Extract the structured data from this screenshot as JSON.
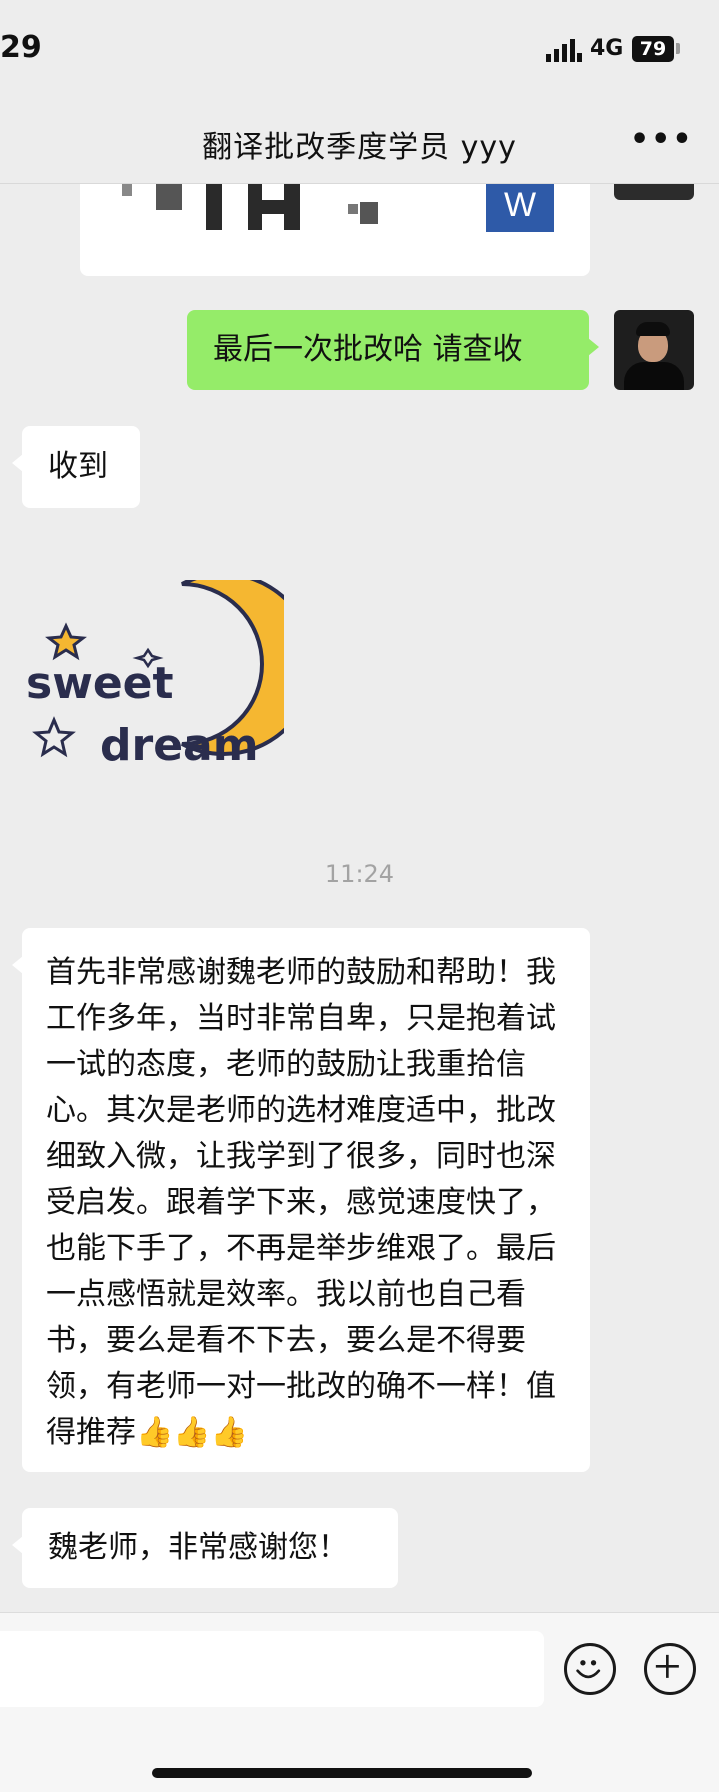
{
  "status_bar": {
    "time": "29",
    "network": "4G",
    "battery": "79"
  },
  "header": {
    "title": "翻译批改季度学员 yyy",
    "more_label": "•••"
  },
  "file_card": {
    "icon_letter": "W"
  },
  "messages": [
    {
      "sender": "me",
      "text": "最后一次批改哈 请查收"
    },
    {
      "sender": "other",
      "text": "收到"
    },
    {
      "sender": "other",
      "type": "sticker",
      "sticker_text_1": "sweet",
      "sticker_text_2": "dream"
    },
    {
      "sender": "other",
      "text": "首先非常感谢魏老师的鼓励和帮助！我工作多年，当时非常自卑，只是抱着试一试的态度，老师的鼓励让我重拾信心。其次是老师的选材难度适中，批改细致入微，让我学到了很多，同时也深受启发。跟着学下来，感觉速度快了，也能下手了，不再是举步维艰了。最后一点感悟就是效率。我以前也自己看书，要么是看不下去，要么是不得要领，有老师一对一批改的确不一样！值得推荐"
    },
    {
      "sender": "other",
      "text": "魏老师，非常感谢您！"
    }
  ],
  "timestamp": "11:24",
  "thumbs_emoji": "👍👍👍",
  "colors": {
    "background": "#ededed",
    "my_bubble": "#95ec69",
    "other_bubble": "#ffffff",
    "moon": "#f5b731",
    "sticker_text": "#2a2d4d"
  },
  "icons": {
    "emoji_button": "smiley-face-icon",
    "add_button": "plus-circle-icon"
  }
}
